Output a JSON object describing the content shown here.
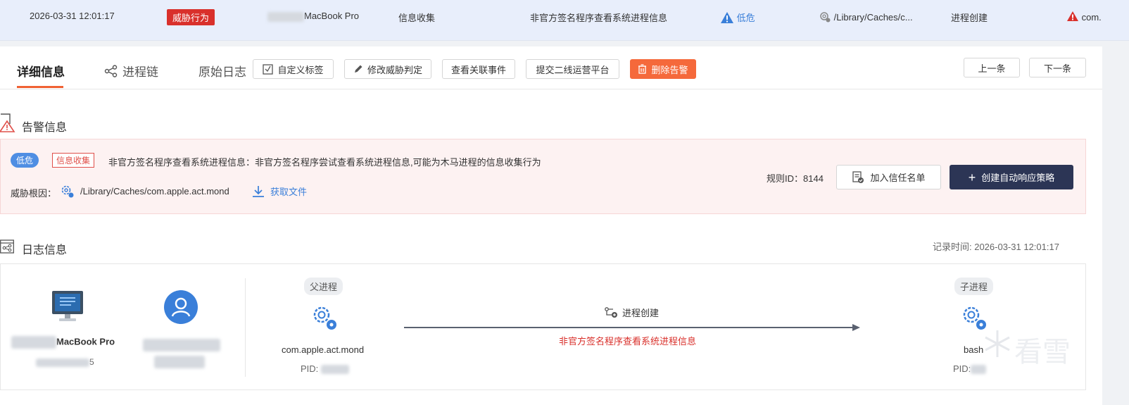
{
  "topbar": {
    "time": "2026-03-31 12:01:17",
    "threat_tag": "威胁行为",
    "host_suffix": "MacBook Pro",
    "category": "信息收集",
    "event_name": "非官方签名程序查看系统进程信息",
    "risk_level": "低危",
    "path": "/Library/Caches/c...",
    "action": "进程创建",
    "extra": "com."
  },
  "tabs": {
    "detail": "详细信息",
    "chain": "进程链",
    "raw_log": "原始日志"
  },
  "toolbar": {
    "custom_tag": "自定义标签",
    "modify_judgement": "修改威胁判定",
    "view_related": "查看关联事件",
    "submit_second_line": "提交二线运营平台",
    "delete_alert": "删除告警",
    "prev": "上一条",
    "next": "下一条"
  },
  "alert": {
    "section_title": "告警信息",
    "level": "低危",
    "category": "信息收集",
    "description": "非官方签名程序查看系统进程信息：非官方签名程序尝试查看系统进程信息,可能为木马进程的信息收集行为",
    "root_label": "威胁根因：",
    "root_path": "/Library/Caches/com.apple.act.mond",
    "get_file": "获取文件",
    "rule_id_label": "规则ID：8144",
    "trust_btn": "加入信任名单",
    "create_policy_btn": "创建自动响应策略"
  },
  "log": {
    "section_title": "日志信息",
    "record_time": "记录时间: 2026-03-31 12:01:17",
    "host_name": "MacBook Pro",
    "host_suffix": "5",
    "parent_label": "父进程",
    "parent_name": "com.apple.act.mond",
    "parent_pid": "PID:",
    "edge_label": "进程创建",
    "edge_desc": "非官方签名程序查看系统进程信息",
    "child_label": "子进程",
    "child_name": "bash",
    "child_pid": "PID:"
  },
  "watermark": "看雪",
  "colors": {
    "accent": "#f06234",
    "danger": "#d9302b",
    "info": "#3a7fd9",
    "dark": "#2c3555"
  }
}
